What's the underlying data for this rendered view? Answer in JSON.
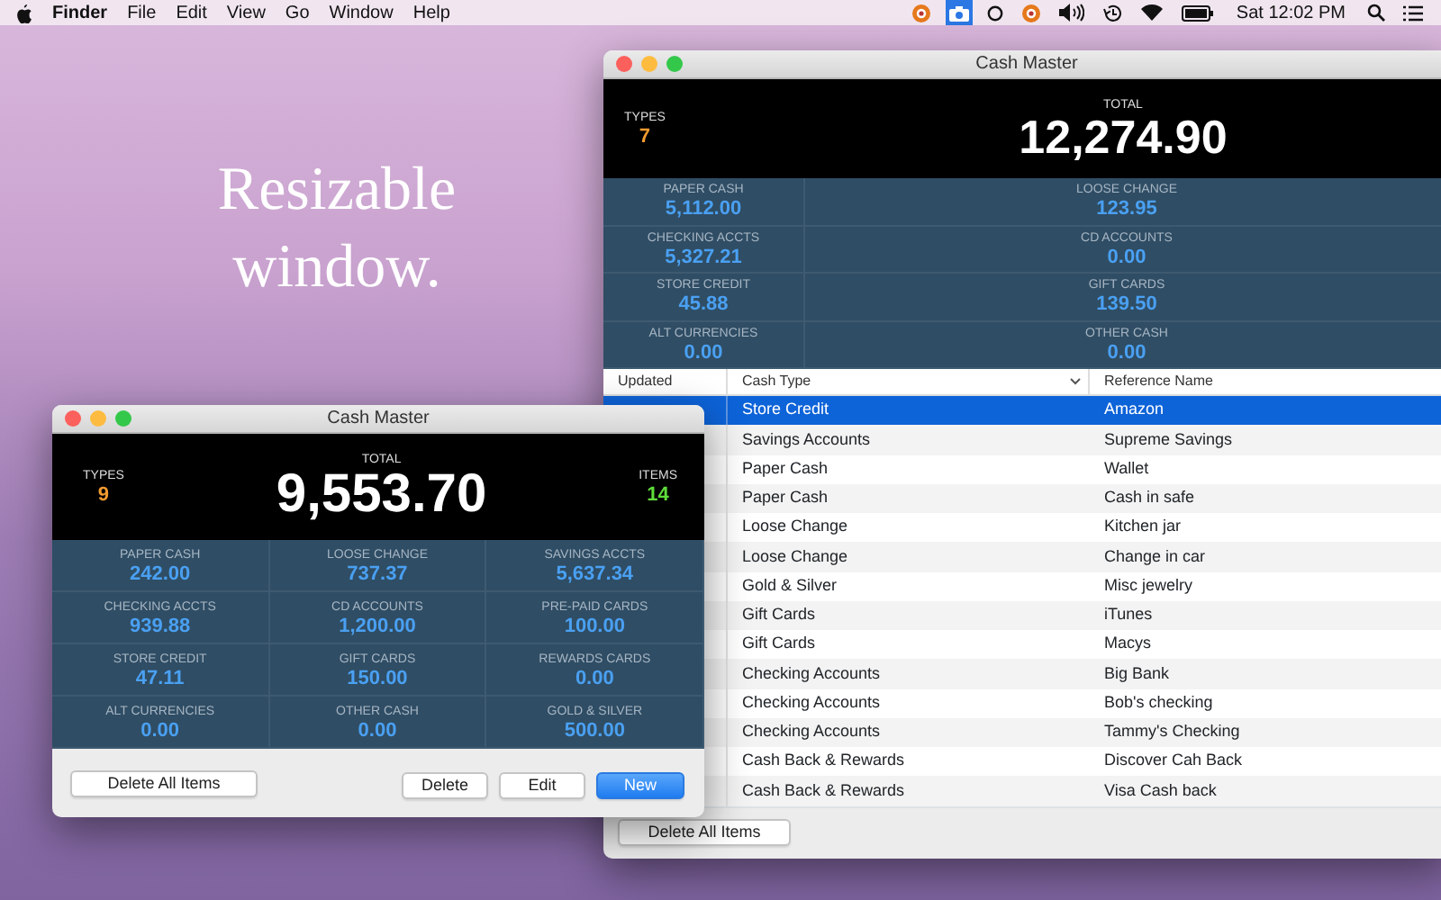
{
  "menu_bar": {
    "app_name": "Finder",
    "menus": [
      "File",
      "Edit",
      "View",
      "Go",
      "Window",
      "Help"
    ],
    "status_items": [
      {
        "kind": "badge",
        "selected": false
      },
      {
        "kind": "camera",
        "selected": true
      },
      {
        "kind": "ring",
        "selected": false
      },
      {
        "kind": "badge",
        "selected": false
      },
      {
        "kind": "volume",
        "selected": false
      },
      {
        "kind": "history",
        "selected": false
      },
      {
        "kind": "wifi",
        "selected": false
      },
      {
        "kind": "battery",
        "selected": false
      }
    ],
    "clock": "Sat 12:02 PM"
  },
  "caption": [
    "Resizable",
    "window."
  ],
  "back_window": {
    "title": "Cash Master",
    "types_label": "TYPES",
    "types_value": "7",
    "total_label": "TOTAL",
    "total_value": "12,274.90",
    "stats": [
      {
        "label": "PAPER CASH",
        "value": "5,112.00"
      },
      {
        "label": "LOOSE CHANGE",
        "value": "123.95"
      },
      {
        "label": "CHECKING ACCTS",
        "value": "5,327.21"
      },
      {
        "label": "CD ACCOUNTS",
        "value": "0.00"
      },
      {
        "label": "STORE CREDIT",
        "value": "45.88"
      },
      {
        "label": "GIFT CARDS",
        "value": "139.50"
      },
      {
        "label": "ALT CURRENCIES",
        "value": "0.00"
      },
      {
        "label": "OTHER CASH",
        "value": "0.00"
      }
    ],
    "table": {
      "columns": [
        {
          "label": "Updated",
          "sorted": false
        },
        {
          "label": "Cash Type",
          "sorted": true
        },
        {
          "label": "Reference Name",
          "sorted": false
        }
      ],
      "rows": [
        {
          "cash_type": "Store Credit",
          "reference_name": "Amazon",
          "selected": true
        },
        {
          "cash_type": "Savings Accounts",
          "reference_name": "Supreme Savings",
          "selected": false
        },
        {
          "cash_type": "Paper Cash",
          "reference_name": "Wallet",
          "selected": false
        },
        {
          "cash_type": "Paper Cash",
          "reference_name": "Cash in safe",
          "selected": false
        },
        {
          "cash_type": "Loose Change",
          "reference_name": "Kitchen jar",
          "selected": false
        },
        {
          "cash_type": "Loose Change",
          "reference_name": "Change in car",
          "selected": false
        },
        {
          "cash_type": "Gold & Silver",
          "reference_name": "Misc jewelry",
          "selected": false
        },
        {
          "cash_type": "Gift Cards",
          "reference_name": "iTunes",
          "selected": false
        },
        {
          "cash_type": "Gift Cards",
          "reference_name": "Macys",
          "selected": false
        },
        {
          "cash_type": "Checking Accounts",
          "reference_name": "Big Bank",
          "selected": false
        },
        {
          "cash_type": "Checking Accounts",
          "reference_name": "Bob's checking",
          "selected": false
        },
        {
          "cash_type": "Checking Accounts",
          "reference_name": "Tammy's Checking",
          "selected": false
        },
        {
          "cash_type": "Cash Back & Rewards",
          "reference_name": "Discover Cah Back",
          "selected": false
        },
        {
          "cash_type": "Cash Back & Rewards",
          "reference_name": "Visa Cash back",
          "selected": false
        }
      ]
    },
    "buttons": [
      {
        "label": "Delete All Items",
        "default": false
      }
    ]
  },
  "front_window": {
    "title": "Cash Master",
    "types_label": "TYPES",
    "types_value": "9",
    "total_label": "TOTAL",
    "total_value": "9,553.70",
    "items_label": "ITEMS",
    "items_value": "14",
    "stats": [
      {
        "label": "PAPER CASH",
        "value": "242.00"
      },
      {
        "label": "LOOSE CHANGE",
        "value": "737.37"
      },
      {
        "label": "SAVINGS ACCTS",
        "value": "5,637.34"
      },
      {
        "label": "CHECKING ACCTS",
        "value": "939.88"
      },
      {
        "label": "CD ACCOUNTS",
        "value": "1,200.00"
      },
      {
        "label": "PRE-PAID CARDS",
        "value": "100.00"
      },
      {
        "label": "STORE CREDIT",
        "value": "47.11"
      },
      {
        "label": "GIFT CARDS",
        "value": "150.00"
      },
      {
        "label": "REWARDS CARDS",
        "value": "0.00"
      },
      {
        "label": "ALT CURRENCIES",
        "value": "0.00"
      },
      {
        "label": "OTHER CASH",
        "value": "0.00"
      },
      {
        "label": "GOLD & SILVER",
        "value": "500.00"
      }
    ],
    "buttons": [
      {
        "label": "Delete All Items",
        "default": false
      },
      {
        "label": "Delete",
        "default": false
      },
      {
        "label": "Edit",
        "default": false
      },
      {
        "label": "New",
        "default": true
      }
    ]
  }
}
